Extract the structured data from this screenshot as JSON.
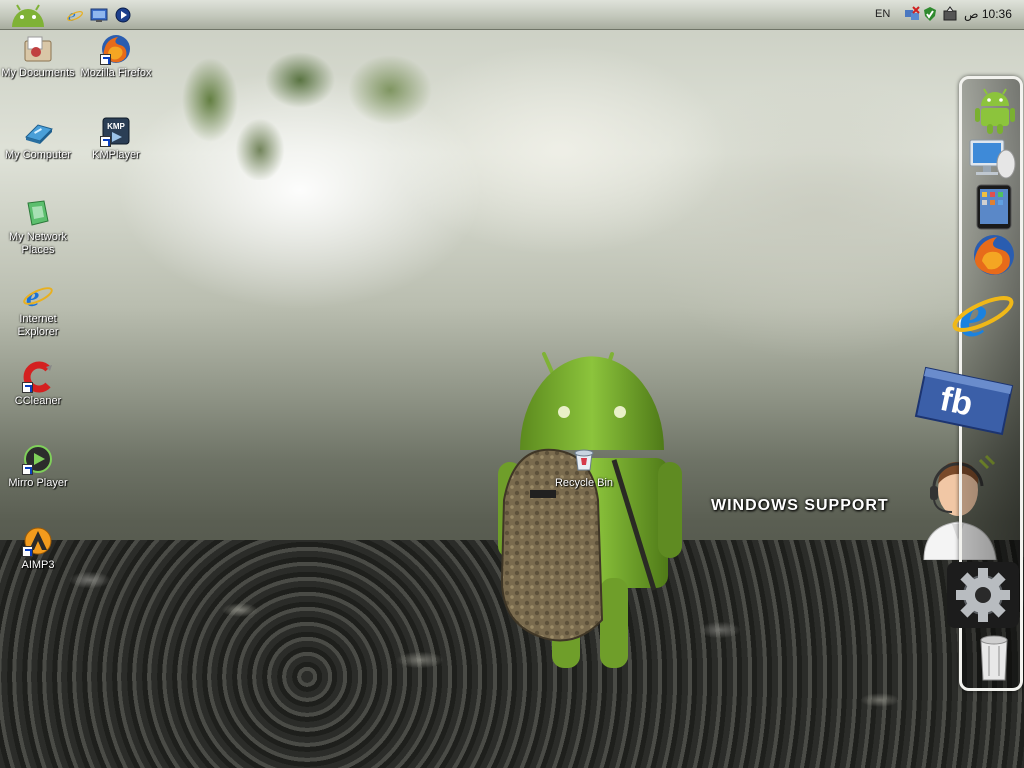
{
  "taskbar": {
    "language": "EN",
    "clock": "10:36 ص",
    "quick_launch": [
      "internet-explorer-icon",
      "show-desktop-icon",
      "media-player-icon"
    ],
    "tray_icons": [
      "network-icon",
      "security-icon",
      "safely-remove-hardware-icon"
    ]
  },
  "desktop": {
    "icons": [
      {
        "label": "My Documents",
        "icon": "folder-documents-icon"
      },
      {
        "label": "Mozilla Firefox",
        "icon": "firefox-icon",
        "shortcut": true
      },
      {
        "label": "My Computer",
        "icon": "computer-icon"
      },
      {
        "label": "KMPlayer",
        "icon": "kmplayer-icon",
        "shortcut": true
      },
      {
        "label": "My Network Places",
        "icon": "network-places-icon"
      },
      {
        "label": "Internet Explorer",
        "icon": "internet-explorer-icon"
      },
      {
        "label": "CCleaner",
        "icon": "ccleaner-icon",
        "shortcut": true
      },
      {
        "label": "Mirro Player",
        "icon": "mirro-player-icon",
        "shortcut": true
      },
      {
        "label": "AIMP3",
        "icon": "aimp3-icon",
        "shortcut": true
      },
      {
        "label": "Recycle Bin",
        "icon": "recycle-bin-icon"
      }
    ],
    "windows_support_text": "WINDOWS SUPPORT"
  },
  "dock": {
    "items": [
      "android-icon",
      "computer-monitor-icon",
      "tablet-icon",
      "firefox-icon",
      "internet-explorer-icon",
      "facebook-icon",
      "settings-gear-icon",
      "trash-can-icon"
    ]
  },
  "colors": {
    "android_green": "#8cc43c",
    "topbar": "#c3c8bc",
    "dock_border": "#f2f2ee"
  }
}
